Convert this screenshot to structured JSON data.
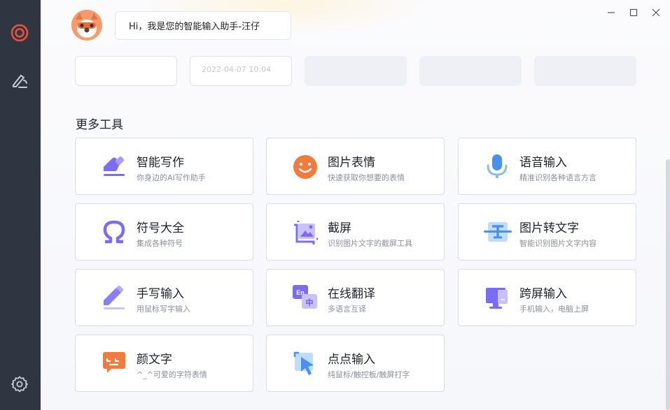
{
  "assistant": {
    "greeting": "Hi，我是您的智能输入助手-汪仔"
  },
  "top_cards": {
    "date_text": "2022-04-07 10:04"
  },
  "section": {
    "title": "更多工具"
  },
  "tools": [
    {
      "name": "智能写作",
      "desc": "你身边的AI写作助手"
    },
    {
      "name": "图片表情",
      "desc": "快速获取你想要的表情"
    },
    {
      "name": "语音输入",
      "desc": "精准识别各种语言方言"
    },
    {
      "name": "符号大全",
      "desc": "集成各种符号"
    },
    {
      "name": "截屏",
      "desc": "识别图片文字的截屏工具"
    },
    {
      "name": "图片转文字",
      "desc": "智能识别图片文字内容"
    },
    {
      "name": "手写输入",
      "desc": "用鼠标写字输入"
    },
    {
      "name": "在线翻译",
      "desc": "多语言互译"
    },
    {
      "name": "跨屏输入",
      "desc": "手机输入，电脑上屏"
    },
    {
      "name": "颜文字",
      "desc": "^_^可爱的字符表情"
    },
    {
      "name": "点点输入",
      "desc": "纯鼠标/触控板/触屏打字"
    }
  ],
  "colors": {
    "sidebar": "#2f3541",
    "accent": "#e8513a",
    "purple": "#7b6cf6",
    "orange": "#f27a3c",
    "blue": "#4a90ef"
  }
}
